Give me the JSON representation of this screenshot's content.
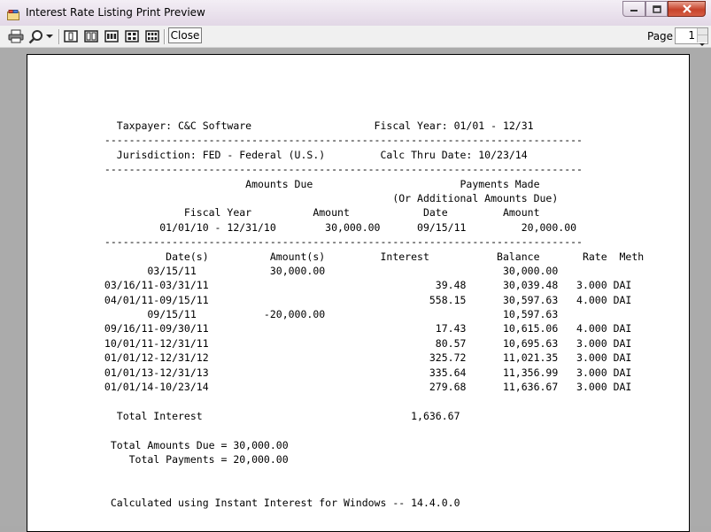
{
  "window": {
    "title": "Interest Rate Listing Print Preview"
  },
  "toolbar": {
    "icons": [
      "print-icon",
      "zoom-icon",
      "dropdown-arrow-icon",
      "one-page-icon",
      "two-pages-icon",
      "three-pages-icon",
      "four-pages-icon",
      "six-pages-icon"
    ],
    "close_label": "Close",
    "page_label": "Page",
    "page_value": "1"
  },
  "report": {
    "lines": [
      "   Taxpayer: C&C Software                    Fiscal Year: 01/01 - 12/31",
      " ------------------------------------------------------------------------------",
      "   Jurisdiction: FED - Federal (U.S.)         Calc Thru Date: 10/23/14",
      " ------------------------------------------------------------------------------",
      "                        Amounts Due                        Payments Made",
      "                                                (Or Additional Amounts Due)",
      "              Fiscal Year          Amount            Date         Amount",
      "          01/01/10 - 12/31/10        30,000.00      09/15/11         20,000.00",
      " ------------------------------------------------------------------------------",
      "           Date(s)          Amount(s)         Interest           Balance       Rate  Meth",
      "        03/15/11            30,000.00                             30,000.00",
      " 03/16/11-03/31/11                                     39.48      30,039.48   3.000 DAI",
      " 04/01/11-09/15/11                                    558.15      30,597.63   4.000 DAI",
      "        09/15/11           -20,000.00                             10,597.63",
      " 09/16/11-09/30/11                                     17.43      10,615.06   4.000 DAI",
      " 10/01/11-12/31/11                                     80.57      10,695.63   3.000 DAI",
      " 01/01/12-12/31/12                                    325.72      11,021.35   3.000 DAI",
      " 01/01/13-12/31/13                                    335.64      11,356.99   3.000 DAI",
      " 01/01/14-10/23/14                                    279.68      11,636.67   3.000 DAI",
      "",
      "   Total Interest                                  1,636.67",
      "",
      "  Total Amounts Due = 30,000.00",
      "     Total Payments = 20,000.00",
      "",
      "",
      "  Calculated using Instant Interest for Windows -- 14.4.0.0"
    ]
  }
}
